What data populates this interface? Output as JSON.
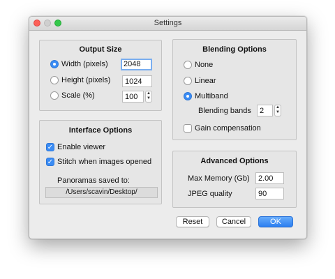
{
  "window": {
    "title": "Settings"
  },
  "output_size": {
    "title": "Output Size",
    "options": [
      {
        "label": "Width (pixels)",
        "value": "2048",
        "selected": true
      },
      {
        "label": "Height (pixels)",
        "value": "1024",
        "selected": false
      },
      {
        "label": "Scale (%)",
        "value": "100",
        "selected": false
      }
    ]
  },
  "interface": {
    "title": "Interface Options",
    "enable_viewer": {
      "label": "Enable viewer",
      "checked": true
    },
    "stitch_when_opened": {
      "label": "Stitch when images opened",
      "checked": true
    },
    "saved_to_label": "Panoramas saved to:",
    "saved_to_path": "/Users/scavin/Desktop/"
  },
  "blending": {
    "title": "Blending Options",
    "none_label": "None",
    "linear_label": "Linear",
    "multiband_label": "Multiband",
    "selected": "Multiband",
    "bands_label": "Blending bands",
    "bands_value": "2",
    "gain_label": "Gain compensation",
    "gain_checked": false
  },
  "advanced": {
    "title": "Advanced Options",
    "max_memory_label": "Max Memory (Gb)",
    "max_memory_value": "2.00",
    "jpeg_quality_label": "JPEG quality",
    "jpeg_quality_value": "90"
  },
  "buttons": {
    "reset": "Reset",
    "cancel": "Cancel",
    "ok": "OK"
  },
  "colors": {
    "accent": "#3b8cf4",
    "window_bg": "#ececec"
  }
}
